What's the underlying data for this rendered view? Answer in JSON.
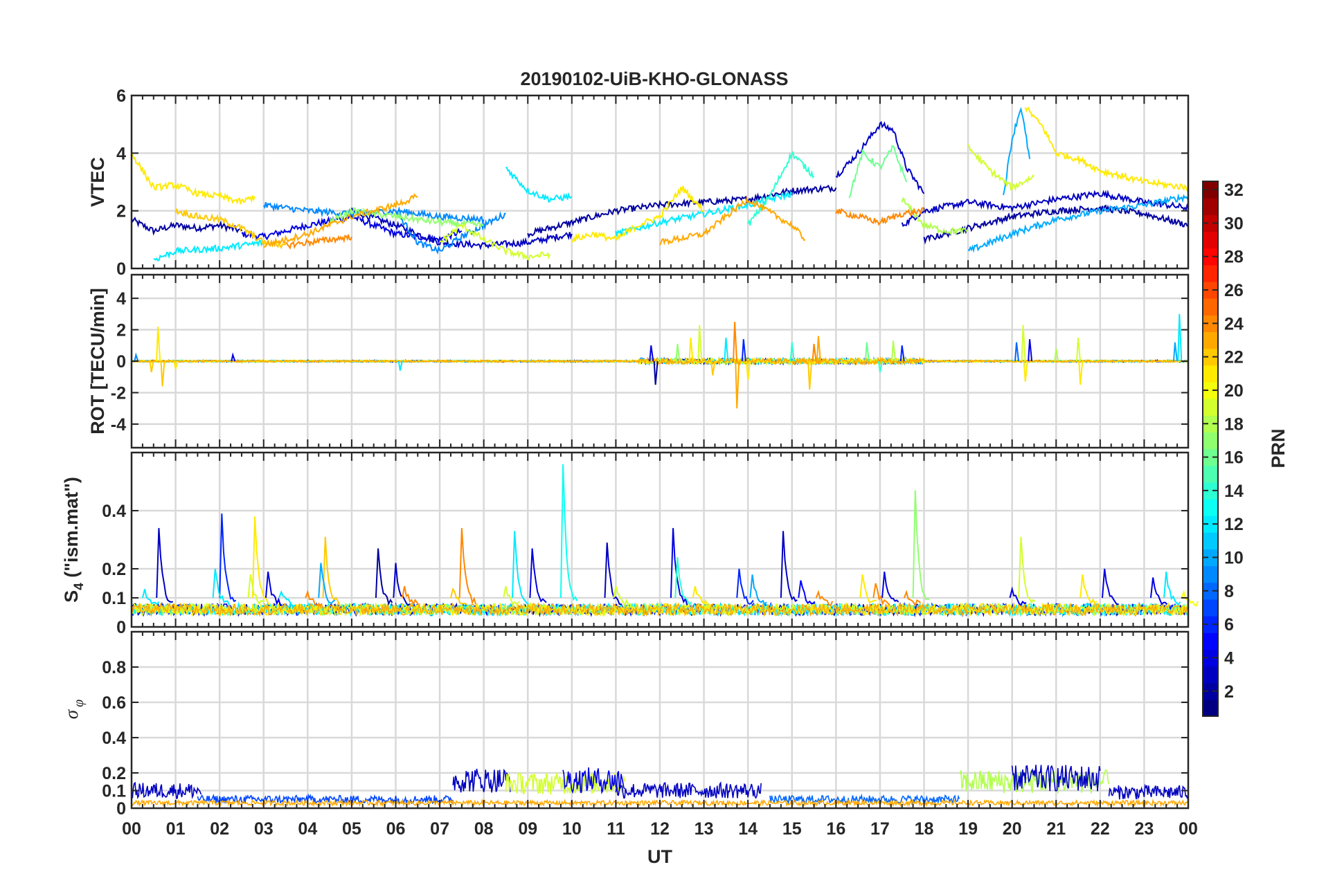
{
  "title": "20190102-UiB-KHO-GLONASS",
  "xlabel": "UT",
  "x_ticks": [
    "00",
    "01",
    "02",
    "03",
    "04",
    "05",
    "06",
    "07",
    "08",
    "09",
    "10",
    "11",
    "12",
    "13",
    "14",
    "15",
    "16",
    "17",
    "18",
    "19",
    "20",
    "21",
    "22",
    "23",
    "00"
  ],
  "panels": [
    {
      "name": "vtec",
      "ylabel": "VTEC",
      "ylim": [
        0,
        6
      ],
      "yticks": [
        0,
        2,
        4,
        6
      ],
      "tick_labels": [
        "0",
        "2",
        "4",
        "6"
      ]
    },
    {
      "name": "rot",
      "ylabel": "ROT [TECU/min]",
      "ylim": [
        -5.5,
        5.5
      ],
      "yticks": [
        -4,
        -2,
        0,
        2,
        4
      ],
      "tick_labels": [
        "-4",
        "-2",
        "0",
        "2",
        "4"
      ]
    },
    {
      "name": "s4",
      "ylabel_main": "S",
      "ylabel_sub": "4",
      "ylabel_tail": " (\"ism.mat\")",
      "ylim": [
        0,
        0.6
      ],
      "yticks": [
        0,
        0.1,
        0.2,
        0.4
      ],
      "tick_labels": [
        "0",
        "0.1",
        "0.2",
        "0.4"
      ]
    },
    {
      "name": "sigma-phi",
      "ylabel_main": "σ",
      "ylabel_sub": "φ",
      "ylim": [
        0,
        1
      ],
      "yticks": [
        0,
        0.1,
        0.2,
        0.4,
        0.6,
        0.8
      ],
      "tick_labels": [
        "0",
        "0.1",
        "0.2",
        "0.4",
        "0.6",
        "0.8"
      ]
    }
  ],
  "colorbar": {
    "label": "PRN",
    "colormap": "jet",
    "range": [
      1,
      32
    ],
    "ticks": [
      2,
      4,
      6,
      8,
      10,
      12,
      14,
      16,
      18,
      20,
      22,
      24,
      26,
      28,
      30,
      32
    ],
    "tick_labels": [
      "2",
      "4",
      "6",
      "8",
      "10",
      "12",
      "14",
      "16",
      "18",
      "20",
      "22",
      "24",
      "26",
      "28",
      "30",
      "32"
    ]
  },
  "chart_data": [
    {
      "type": "line",
      "title": "20190102-UiB-KHO-GLONASS",
      "xlabel": "UT",
      "ylabel": "VTEC",
      "xlim": [
        0,
        24
      ],
      "ylim": [
        0,
        6
      ],
      "grid": true,
      "series": [
        {
          "prn": 2,
          "x": [
            0,
            0.5,
            1,
            1.5,
            2,
            2.5
          ],
          "y": [
            1.7,
            1.3,
            1.5,
            1.4,
            1.5,
            1.3
          ]
        },
        {
          "prn": 4,
          "x": [
            2.5,
            3,
            4,
            5,
            6,
            7,
            7.5
          ],
          "y": [
            1.2,
            1.1,
            1.5,
            1.8,
            1.2,
            1.0,
            1.3
          ]
        },
        {
          "prn": 3,
          "x": [
            5,
            6,
            7,
            8,
            9,
            10
          ],
          "y": [
            2.0,
            1.5,
            0.9,
            0.8,
            0.9,
            1.2
          ]
        },
        {
          "prn": 2,
          "x": [
            9,
            10,
            11,
            12,
            13,
            14,
            15,
            16
          ],
          "y": [
            1.2,
            1.6,
            2.0,
            2.2,
            2.3,
            2.4,
            2.7,
            2.8
          ]
        },
        {
          "prn": 3,
          "x": [
            16,
            16.5,
            17,
            17.3,
            17.6,
            18
          ],
          "y": [
            3.2,
            4.0,
            5.0,
            4.8,
            3.5,
            2.6
          ]
        },
        {
          "prn": 3,
          "x": [
            17.5,
            18,
            19,
            20,
            21,
            22,
            23,
            24
          ],
          "y": [
            1.5,
            2.0,
            2.3,
            2.1,
            2.4,
            2.6,
            2.3,
            2.1
          ]
        },
        {
          "prn": 2,
          "x": [
            18,
            19,
            20,
            21,
            22,
            23,
            24
          ],
          "y": [
            1.0,
            1.4,
            1.8,
            2.0,
            2.1,
            1.9,
            1.5
          ]
        },
        {
          "prn": 9,
          "x": [
            3,
            4,
            5,
            6,
            7,
            8
          ],
          "y": [
            2.2,
            2.0,
            1.9,
            2.0,
            1.8,
            1.7
          ]
        },
        {
          "prn": 9,
          "x": [
            6,
            6.5,
            7,
            7.5,
            8,
            8.5
          ],
          "y": [
            2.0,
            0.9,
            0.6,
            1.1,
            1.5,
            1.9
          ]
        },
        {
          "prn": 10,
          "x": [
            19.8,
            20,
            20.2,
            20.4
          ],
          "y": [
            2.5,
            4.5,
            5.6,
            3.8
          ]
        },
        {
          "prn": 10,
          "x": [
            19,
            20,
            21,
            22,
            23,
            24
          ],
          "y": [
            0.6,
            1.2,
            1.7,
            2.0,
            2.2,
            2.5
          ]
        },
        {
          "prn": 12,
          "x": [
            0.5,
            1,
            2,
            3
          ],
          "y": [
            0.3,
            0.6,
            0.7,
            0.9
          ]
        },
        {
          "prn": 12,
          "x": [
            8.5,
            9,
            9.5,
            10
          ],
          "y": [
            3.5,
            2.7,
            2.4,
            2.5
          ]
        },
        {
          "prn": 12,
          "x": [
            11,
            12,
            13,
            14,
            15
          ],
          "y": [
            1.2,
            1.6,
            1.9,
            2.2,
            2.6
          ]
        },
        {
          "prn": 14,
          "x": [
            14,
            14.5,
            15,
            15.5
          ],
          "y": [
            1.5,
            2.5,
            4.0,
            3.2
          ]
        },
        {
          "prn": 16,
          "x": [
            16.3,
            16.6,
            17,
            17.3,
            17.6
          ],
          "y": [
            2.5,
            4.0,
            3.5,
            4.2,
            3.0
          ]
        },
        {
          "prn": 17,
          "x": [
            4.5,
            5,
            6,
            7,
            8
          ],
          "y": [
            1.6,
            2.0,
            1.8,
            1.6,
            1.5
          ]
        },
        {
          "prn": 18,
          "x": [
            17.5,
            18,
            18.5,
            19
          ],
          "y": [
            2.4,
            1.5,
            1.3,
            1.3
          ]
        },
        {
          "prn": 19,
          "x": [
            7,
            7.5,
            8,
            8.5,
            9,
            9.5
          ],
          "y": [
            0.9,
            1.5,
            1.0,
            0.6,
            0.4,
            0.5
          ]
        },
        {
          "prn": 19,
          "x": [
            19,
            19.5,
            20,
            20.5
          ],
          "y": [
            4.2,
            3.4,
            2.8,
            3.2
          ]
        },
        {
          "prn": 21,
          "x": [
            0,
            0.5,
            1,
            1.5,
            2,
            2.5,
            2.8
          ],
          "y": [
            4.0,
            2.8,
            2.9,
            2.6,
            2.5,
            2.3,
            2.5
          ]
        },
        {
          "prn": 21,
          "x": [
            20.3,
            20.7,
            21,
            21.5,
            22,
            22.5,
            23,
            24
          ],
          "y": [
            5.6,
            4.9,
            4.0,
            3.8,
            3.4,
            3.2,
            3.0,
            2.8
          ]
        },
        {
          "prn": 21,
          "x": [
            10,
            10.5,
            11,
            11.5,
            12,
            12.5,
            13
          ],
          "y": [
            1.0,
            1.2,
            1.0,
            1.5,
            1.8,
            2.8,
            2.0
          ]
        },
        {
          "prn": 22,
          "x": [
            1,
            1.5,
            2,
            2.5,
            3,
            3.5
          ],
          "y": [
            2.0,
            1.8,
            1.7,
            1.4,
            0.9,
            0.8
          ]
        },
        {
          "prn": 23,
          "x": [
            3,
            4,
            5,
            6,
            6.5
          ],
          "y": [
            0.8,
            1.2,
            1.8,
            2.2,
            2.5
          ]
        },
        {
          "prn": 24,
          "x": [
            3.5,
            4,
            4.5,
            5
          ],
          "y": [
            0.8,
            0.9,
            1.0,
            1.1
          ]
        },
        {
          "prn": 23,
          "x": [
            12,
            13,
            14,
            15,
            15.3
          ],
          "y": [
            0.9,
            1.2,
            2.4,
            1.5,
            1.0
          ]
        },
        {
          "prn": 24,
          "x": [
            16,
            17,
            17.5,
            18
          ],
          "y": [
            2.0,
            1.6,
            1.9,
            2.0
          ]
        }
      ]
    },
    {
      "type": "line",
      "ylabel": "ROT [TECU/min]",
      "xlim": [
        0,
        24
      ],
      "ylim": [
        -5.5,
        5.5
      ],
      "grid": true,
      "baseline": 0,
      "spikes": [
        {
          "x": 0.1,
          "y": 0.4,
          "prn": 9
        },
        {
          "x": 0.45,
          "y": -0.7,
          "prn": 22
        },
        {
          "x": 0.6,
          "y": 2.2,
          "prn": 21
        },
        {
          "x": 0.7,
          "y": -1.6,
          "prn": 22
        },
        {
          "x": 1.0,
          "y": -0.5,
          "prn": 21
        },
        {
          "x": 2.3,
          "y": 0.4,
          "prn": 4
        },
        {
          "x": 6.1,
          "y": -0.6,
          "prn": 12
        },
        {
          "x": 11.8,
          "y": 1.0,
          "prn": 4
        },
        {
          "x": 11.9,
          "y": -1.5,
          "prn": 2
        },
        {
          "x": 12.4,
          "y": 1.1,
          "prn": 17
        },
        {
          "x": 12.7,
          "y": 1.5,
          "prn": 21
        },
        {
          "x": 12.9,
          "y": 2.3,
          "prn": 19
        },
        {
          "x": 13.2,
          "y": -0.9,
          "prn": 22
        },
        {
          "x": 13.5,
          "y": 1.5,
          "prn": 12
        },
        {
          "x": 13.7,
          "y": 2.5,
          "prn": 24
        },
        {
          "x": 13.75,
          "y": -3.0,
          "prn": 23
        },
        {
          "x": 13.9,
          "y": 1.4,
          "prn": 6
        },
        {
          "x": 14.0,
          "y": -1.2,
          "prn": 21
        },
        {
          "x": 15.0,
          "y": 1.2,
          "prn": 14
        },
        {
          "x": 15.4,
          "y": -1.8,
          "prn": 22
        },
        {
          "x": 15.5,
          "y": 1.1,
          "prn": 24
        },
        {
          "x": 15.6,
          "y": 1.6,
          "prn": 23
        },
        {
          "x": 16.7,
          "y": 1.2,
          "prn": 16
        },
        {
          "x": 17.0,
          "y": -0.7,
          "prn": 14
        },
        {
          "x": 17.3,
          "y": 1.3,
          "prn": 18
        },
        {
          "x": 17.5,
          "y": 1.0,
          "prn": 6
        },
        {
          "x": 20.1,
          "y": 1.2,
          "prn": 8
        },
        {
          "x": 20.25,
          "y": 2.3,
          "prn": 19
        },
        {
          "x": 20.3,
          "y": -1.3,
          "prn": 21
        },
        {
          "x": 20.4,
          "y": 1.4,
          "prn": 4
        },
        {
          "x": 21.0,
          "y": 0.8,
          "prn": 18
        },
        {
          "x": 21.5,
          "y": 1.5,
          "prn": 19
        },
        {
          "x": 21.55,
          "y": -1.5,
          "prn": 21
        },
        {
          "x": 23.8,
          "y": 3.0,
          "prn": 12
        },
        {
          "x": 23.7,
          "y": 1.2,
          "prn": 10
        }
      ]
    },
    {
      "type": "line",
      "ylabel": "S4 (\"ism.mat\")",
      "xlim": [
        0,
        24
      ],
      "ylim": [
        0,
        0.6
      ],
      "grid": true,
      "background_level": 0.06,
      "peaks": [
        {
          "x": 0.62,
          "y": 0.34,
          "prn": 3
        },
        {
          "x": 0.3,
          "y": 0.13,
          "prn": 12
        },
        {
          "x": 2.05,
          "y": 0.39,
          "prn": 6
        },
        {
          "x": 1.9,
          "y": 0.2,
          "prn": 12
        },
        {
          "x": 2.8,
          "y": 0.38,
          "prn": 21
        },
        {
          "x": 2.7,
          "y": 0.18,
          "prn": 19
        },
        {
          "x": 3.1,
          "y": 0.19,
          "prn": 4
        },
        {
          "x": 3.4,
          "y": 0.12,
          "prn": 12
        },
        {
          "x": 4.4,
          "y": 0.31,
          "prn": 22
        },
        {
          "x": 4.3,
          "y": 0.22,
          "prn": 10
        },
        {
          "x": 4.0,
          "y": 0.12,
          "prn": 24
        },
        {
          "x": 5.6,
          "y": 0.27,
          "prn": 2
        },
        {
          "x": 6.0,
          "y": 0.22,
          "prn": 3
        },
        {
          "x": 6.2,
          "y": 0.14,
          "prn": 24
        },
        {
          "x": 7.5,
          "y": 0.34,
          "prn": 24
        },
        {
          "x": 7.3,
          "y": 0.13,
          "prn": 22
        },
        {
          "x": 8.7,
          "y": 0.33,
          "prn": 12
        },
        {
          "x": 9.1,
          "y": 0.27,
          "prn": 4
        },
        {
          "x": 8.5,
          "y": 0.14,
          "prn": 19
        },
        {
          "x": 9.8,
          "y": 0.56,
          "prn": 13
        },
        {
          "x": 10.8,
          "y": 0.29,
          "prn": 3
        },
        {
          "x": 11.0,
          "y": 0.14,
          "prn": 19
        },
        {
          "x": 12.3,
          "y": 0.34,
          "prn": 4
        },
        {
          "x": 12.4,
          "y": 0.24,
          "prn": 14
        },
        {
          "x": 12.8,
          "y": 0.14,
          "prn": 21
        },
        {
          "x": 13.8,
          "y": 0.2,
          "prn": 6
        },
        {
          "x": 14.1,
          "y": 0.18,
          "prn": 10
        },
        {
          "x": 14.8,
          "y": 0.33,
          "prn": 3
        },
        {
          "x": 15.2,
          "y": 0.16,
          "prn": 5
        },
        {
          "x": 15.6,
          "y": 0.12,
          "prn": 24
        },
        {
          "x": 16.6,
          "y": 0.18,
          "prn": 21
        },
        {
          "x": 17.1,
          "y": 0.19,
          "prn": 4
        },
        {
          "x": 16.9,
          "y": 0.15,
          "prn": 24
        },
        {
          "x": 17.8,
          "y": 0.47,
          "prn": 17
        },
        {
          "x": 17.6,
          "y": 0.12,
          "prn": 24
        },
        {
          "x": 20.2,
          "y": 0.31,
          "prn": 19
        },
        {
          "x": 20.0,
          "y": 0.13,
          "prn": 4
        },
        {
          "x": 21.6,
          "y": 0.18,
          "prn": 21
        },
        {
          "x": 22.1,
          "y": 0.2,
          "prn": 4
        },
        {
          "x": 23.2,
          "y": 0.17,
          "prn": 4
        },
        {
          "x": 23.5,
          "y": 0.19,
          "prn": 12
        },
        {
          "x": 23.9,
          "y": 0.12,
          "prn": 20
        }
      ]
    },
    {
      "type": "line",
      "ylabel": "σφ",
      "xlim": [
        0,
        24
      ],
      "ylim": [
        0,
        1
      ],
      "grid": true,
      "bands": [
        {
          "x_start": 0,
          "x_end": 1.6,
          "level": 0.1,
          "prn": 3
        },
        {
          "x_start": 1.5,
          "x_end": 7.3,
          "level": 0.05,
          "prn": 7
        },
        {
          "x_start": 7.3,
          "x_end": 8.6,
          "level": 0.16,
          "prn": 3
        },
        {
          "x_start": 8.5,
          "x_end": 11.2,
          "level": 0.14,
          "prn": 19
        },
        {
          "x_start": 9.8,
          "x_end": 11.2,
          "level": 0.16,
          "prn": 4
        },
        {
          "x_start": 11.0,
          "x_end": 14.3,
          "level": 0.1,
          "prn": 3
        },
        {
          "x_start": 14.5,
          "x_end": 18.8,
          "level": 0.05,
          "prn": 8
        },
        {
          "x_start": 18.8,
          "x_end": 22.2,
          "level": 0.15,
          "prn": 18
        },
        {
          "x_start": 20.0,
          "x_end": 22.0,
          "level": 0.17,
          "prn": 3
        },
        {
          "x_start": 22.2,
          "x_end": 24,
          "level": 0.09,
          "prn": 3
        },
        {
          "x_start": 0,
          "x_end": 24,
          "level": 0.03,
          "prn": 23
        }
      ]
    }
  ]
}
